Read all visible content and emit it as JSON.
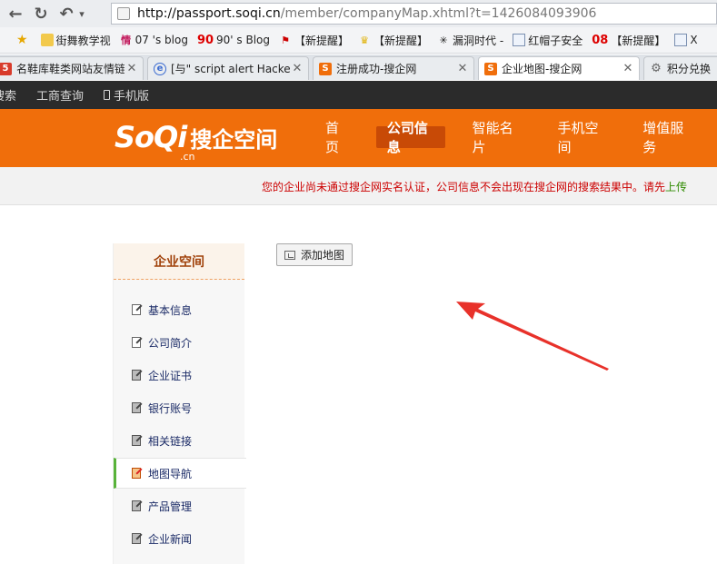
{
  "browser": {
    "url_domain": "http://passport.soqi.cn",
    "url_path": "/member/companyMap.xhtml?t=1426084093906",
    "bookmarks": [
      {
        "label": "街舞教学视"
      },
      {
        "label": "07 's blog"
      },
      {
        "label": "90' s Blog",
        "icon_text": "90"
      },
      {
        "label": "【新提醒】"
      },
      {
        "label": "【新提醒】"
      },
      {
        "label": "漏洞时代 -"
      },
      {
        "label": "红帽子安全"
      },
      {
        "label": "【新提醒】",
        "icon_text": "08"
      },
      {
        "label": "X"
      }
    ],
    "tabs": [
      {
        "title": "名鞋库鞋类网站友情链接"
      },
      {
        "title": "[与\" script alert Hacker"
      },
      {
        "title": "注册成功-搜企网"
      },
      {
        "title": "企业地图-搜企网"
      },
      {
        "title": "积分兑换"
      }
    ]
  },
  "site_top": {
    "links": [
      "搜索",
      "工商查询",
      "手机版"
    ]
  },
  "header": {
    "logo_mark": "SoQi",
    "logo_text": "搜企空间",
    "logo_cn": ".cn",
    "nav": [
      "首页",
      "公司信息",
      "智能名片",
      "手机空间",
      "增值服务"
    ],
    "active_nav": "公司信息"
  },
  "notice": {
    "text": "您的企业尚未通过搜企网实名认证，公司信息不会出现在搜企网的搜索结果中。请先",
    "link": "上传"
  },
  "sidebar": {
    "title": "企业空间",
    "items": [
      "基本信息",
      "公司简介",
      "企业证书",
      "银行账号",
      "相关链接",
      "地图导航",
      "产品管理",
      "企业新闻"
    ],
    "active": "地图导航"
  },
  "main": {
    "add_map_label": "添加地图"
  },
  "colors": {
    "header_orange": "#f06e0b",
    "annotation_arrow": "#e8312a"
  }
}
